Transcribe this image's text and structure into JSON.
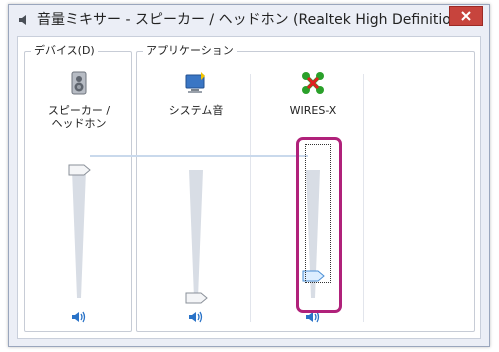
{
  "window": {
    "title": "音量ミキサー - スピーカー / ヘッドホン (Realtek High Definition...",
    "close_label": "✕"
  },
  "groups": {
    "devices_label": "デバイス(D)",
    "apps_label": "アプリケーション"
  },
  "channels": [
    {
      "label": "スピーカー /\nヘッドホン",
      "icon": "speaker-device-icon",
      "volume": 1.0
    },
    {
      "label": "システム音",
      "icon": "system-sounds-icon",
      "volume": 0.0
    },
    {
      "label": "WIRES-X",
      "icon": "wires-x-icon",
      "volume": 0.08
    }
  ],
  "colors": {
    "accent_highlight": "#b0217a",
    "close_button": "#c7443d",
    "speaker_blue": "#2a73c8"
  }
}
